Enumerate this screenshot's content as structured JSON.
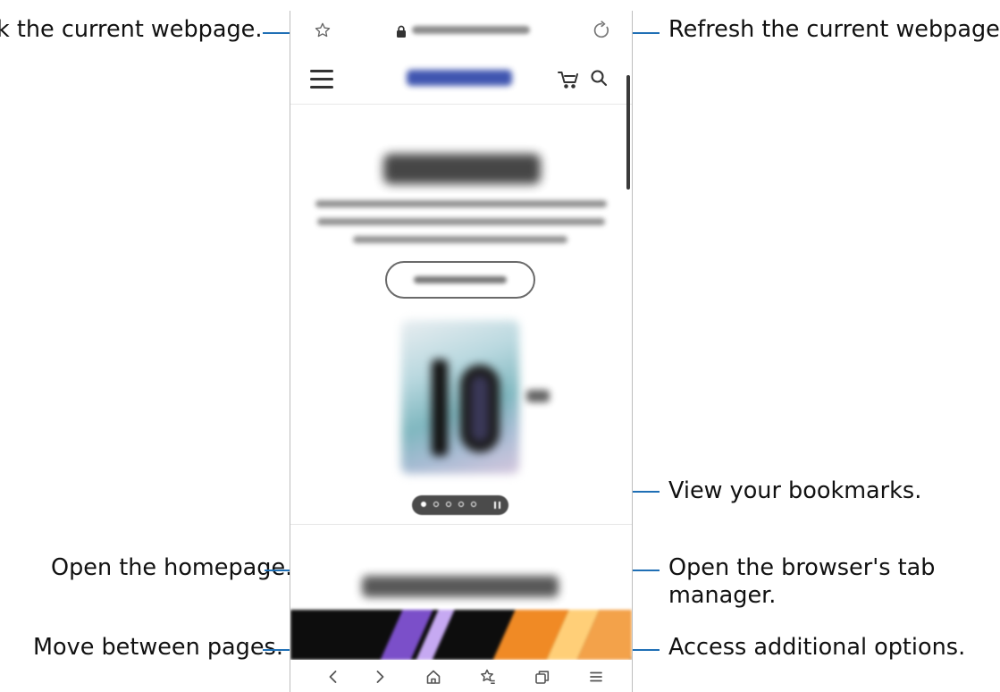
{
  "browser": {
    "url": "www.samsung.com",
    "site_logo": "SAMSUNG",
    "hero": {
      "title": "Power of 10",
      "button": "LEARN MORE"
    },
    "section_title": "Explore our history"
  },
  "callouts": {
    "bookmark_current": "k the current webpage.",
    "refresh": "Refresh the current webpage.",
    "view_bookmarks": "View your bookmarks.",
    "homepage": "Open the homepage.",
    "tab_manager": "Open the browser's tab manager.",
    "move_pages": "Move between pages.",
    "more_options": "Access additional options."
  },
  "icons": {
    "star": "star-icon",
    "lock": "lock-icon",
    "refresh": "refresh-icon",
    "menu": "hamburger-icon",
    "cart": "cart-icon",
    "search": "search-icon",
    "back": "chevron-left-icon",
    "forward": "chevron-right-icon",
    "home": "home-icon",
    "bookmarks": "bookmarks-icon",
    "tabs": "tabs-icon",
    "options": "menu-icon"
  },
  "colors": {
    "callout_line": "#1f6fb5",
    "logo": "#2c44a8"
  }
}
